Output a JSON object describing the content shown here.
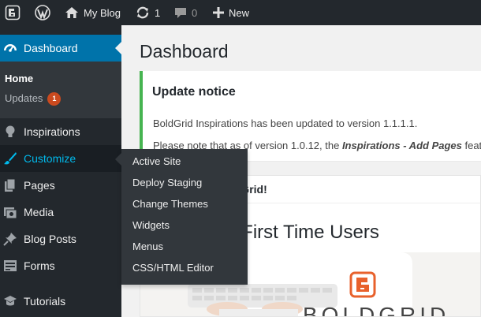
{
  "adminbar": {
    "site_name": "My Blog",
    "updates_count": "1",
    "comments_count": "0",
    "new_label": "New",
    "icons": [
      "boldgrid-logo-icon",
      "wordpress-logo-icon",
      "home-icon",
      "updates-icon",
      "comment-icon",
      "plus-icon"
    ]
  },
  "menu": {
    "dashboard": "Dashboard",
    "submenu": {
      "home": "Home",
      "updates": "Updates",
      "updates_badge": "1"
    },
    "items": [
      {
        "label": "Inspirations",
        "icon": "lightbulb-icon"
      },
      {
        "label": "Customize",
        "icon": "paintbrush-icon"
      },
      {
        "label": "Pages",
        "icon": "pages-icon"
      },
      {
        "label": "Media",
        "icon": "media-icon"
      },
      {
        "label": "Blog Posts",
        "icon": "pin-icon"
      },
      {
        "label": "Forms",
        "icon": "forms-icon"
      },
      {
        "label": "Tutorials",
        "icon": "tutorials-icon"
      }
    ]
  },
  "flyout": {
    "items": [
      "Active Site",
      "Deploy Staging",
      "Change Themes",
      "Widgets",
      "Menus",
      "CSS/HTML Editor"
    ]
  },
  "content": {
    "title": "Dashboard",
    "notice": {
      "heading": "Update notice",
      "line1": "BoldGrid Inspirations has been updated to version 1.1.1.1.",
      "line2_prefix": "Please note that as of version 1.0.12, the ",
      "line2_em": "Inspirations - Add Pages",
      "line2_suffix": " feature"
    },
    "widget": {
      "title_visible": "Welcome to BoldGrid!",
      "heading": "First Time Users",
      "image_logo_text": "BOLDGRID"
    }
  },
  "colors": {
    "adminbar_bg": "#23282d",
    "menu_bg": "#23282d",
    "submenu_bg": "#32373c",
    "active_blue": "#0073aa",
    "hover_blue": "#00b9eb",
    "notice_green": "#46b450",
    "badge_orange": "#ca4a1f",
    "boldgrid_orange": "#e8612c"
  }
}
